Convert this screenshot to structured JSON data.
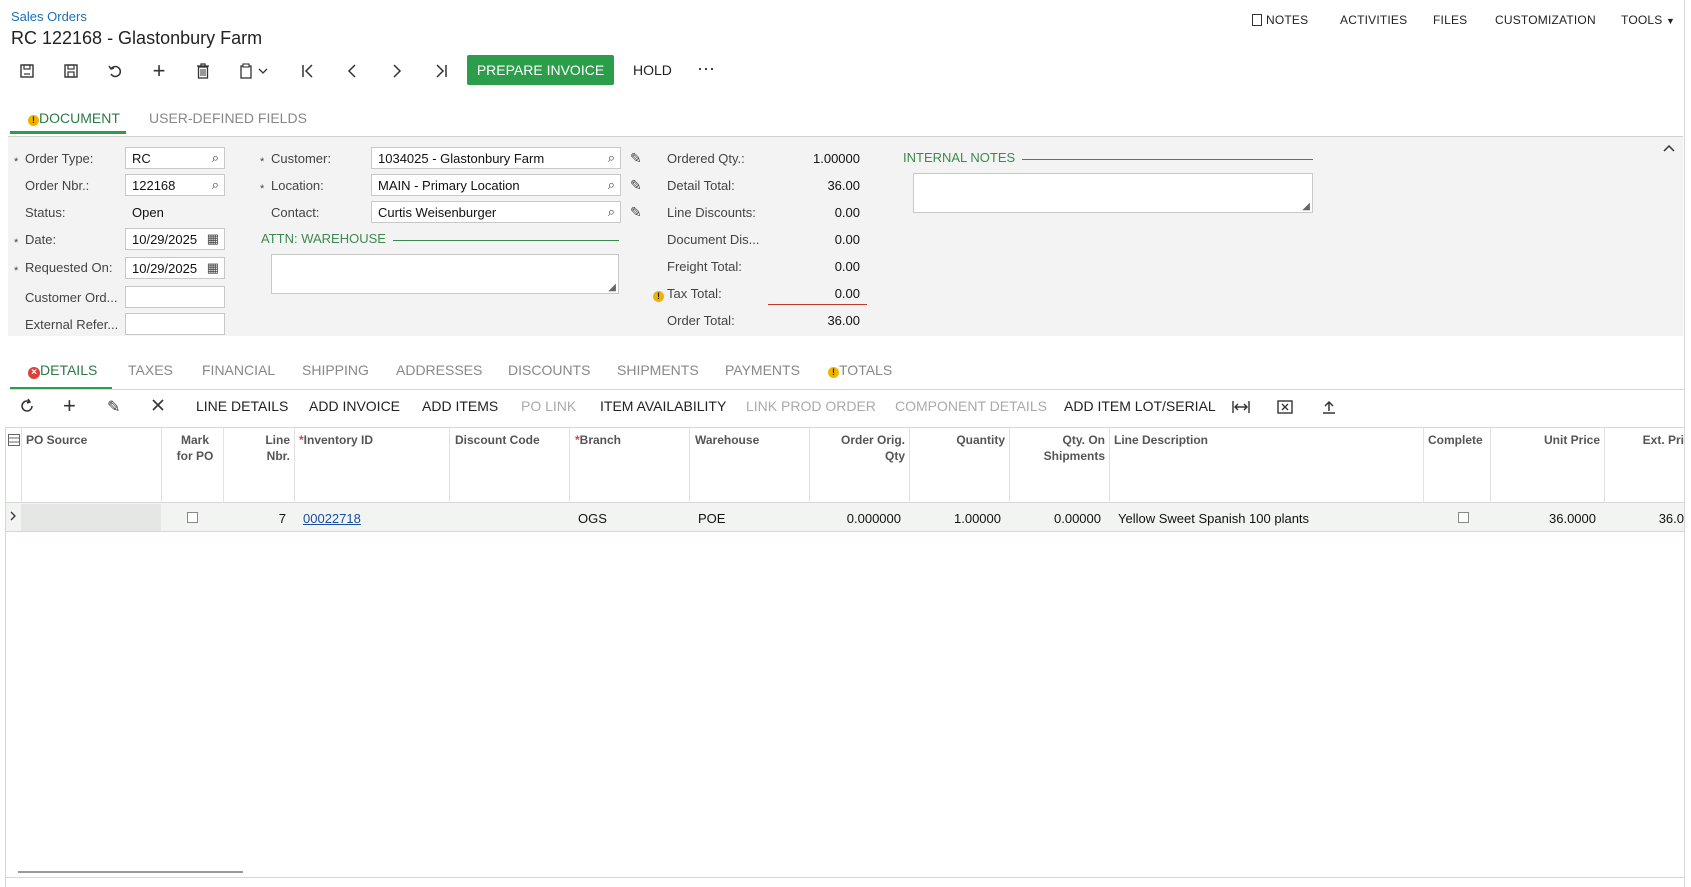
{
  "header": {
    "breadcrumb": "Sales Orders",
    "title": "RC 122168 - Glastonbury Farm",
    "menu": {
      "notes": "NOTES",
      "activities": "ACTIVITIES",
      "files": "FILES",
      "customization": "CUSTOMIZATION",
      "tools": "TOOLS"
    }
  },
  "toolbar": {
    "prepare_invoice": "PREPARE INVOICE",
    "hold": "HOLD",
    "more": "···"
  },
  "tabs_top": {
    "document": "DOCUMENT",
    "user_defined": "USER-DEFINED FIELDS"
  },
  "form": {
    "order_type_label": "Order Type:",
    "order_type": "RC",
    "order_nbr_label": "Order Nbr.:",
    "order_nbr": "122168",
    "status_label": "Status:",
    "status": "Open",
    "date_label": "Date:",
    "date": "10/29/2025",
    "requested_on_label": "Requested On:",
    "requested_on": "10/29/2025",
    "customer_ord_label": "Customer Ord...",
    "customer_ord": "",
    "external_ref_label": "External Refer...",
    "external_ref": "",
    "customer_label": "Customer:",
    "customer": "1034025 - Glastonbury Farm",
    "location_label": "Location:",
    "location": "MAIN - Primary Location",
    "contact_label": "Contact:",
    "contact": "Curtis Weisenburger",
    "attn_warehouse": "ATTN: WAREHOUSE",
    "internal_notes": "INTERNAL NOTES"
  },
  "totals": {
    "ordered_qty_label": "Ordered Qty.:",
    "ordered_qty": "1.00000",
    "detail_total_label": "Detail Total:",
    "detail_total": "36.00",
    "line_discounts_label": "Line Discounts:",
    "line_discounts": "0.00",
    "document_dis_label": "Document Dis...",
    "document_dis": "0.00",
    "freight_total_label": "Freight Total:",
    "freight_total": "0.00",
    "tax_total_label": "Tax Total:",
    "tax_total": "0.00",
    "order_total_label": "Order Total:",
    "order_total": "36.00"
  },
  "tabs_detail": {
    "details": "DETAILS",
    "taxes": "TAXES",
    "financial": "FINANCIAL",
    "shipping": "SHIPPING",
    "addresses": "ADDRESSES",
    "discounts": "DISCOUNTS",
    "shipments": "SHIPMENTS",
    "payments": "PAYMENTS",
    "totals": "TOTALS"
  },
  "grid_toolbar": {
    "line_details": "LINE DETAILS",
    "add_invoice": "ADD INVOICE",
    "add_items": "ADD ITEMS",
    "po_link": "PO LINK",
    "item_availability": "ITEM AVAILABILITY",
    "link_prod_order": "LINK PROD ORDER",
    "component_details": "COMPONENT DETAILS",
    "add_item_lot_serial": "ADD ITEM LOT/SERIAL"
  },
  "grid": {
    "columns": {
      "po_source": "PO Source",
      "mark_for_po_1": "Mark",
      "mark_for_po_2": "for PO",
      "line_nbr_1": "Line",
      "line_nbr_2": "Nbr.",
      "inventory_id": "Inventory ID",
      "discount_code": "Discount Code",
      "branch": "Branch",
      "warehouse": "Warehouse",
      "order_orig_qty_1": "Order Orig.",
      "order_orig_qty_2": "Qty",
      "quantity": "Quantity",
      "qty_on_shipments_1": "Qty. On",
      "qty_on_shipments_2": "Shipments",
      "line_description": "Line Description",
      "completed": "Complete",
      "unit_price": "Unit Price",
      "ext_price": "Ext. Pri"
    },
    "rows": [
      {
        "line_nbr": "7",
        "inventory_id": "00022718",
        "branch": "OGS",
        "warehouse": "POE",
        "order_orig_qty": "0.000000",
        "quantity": "1.00000",
        "qty_on_shipments": "0.00000",
        "line_description": "Yellow Sweet Spanish 100 plants",
        "unit_price": "36.0000",
        "ext_price": "36.0"
      }
    ]
  }
}
